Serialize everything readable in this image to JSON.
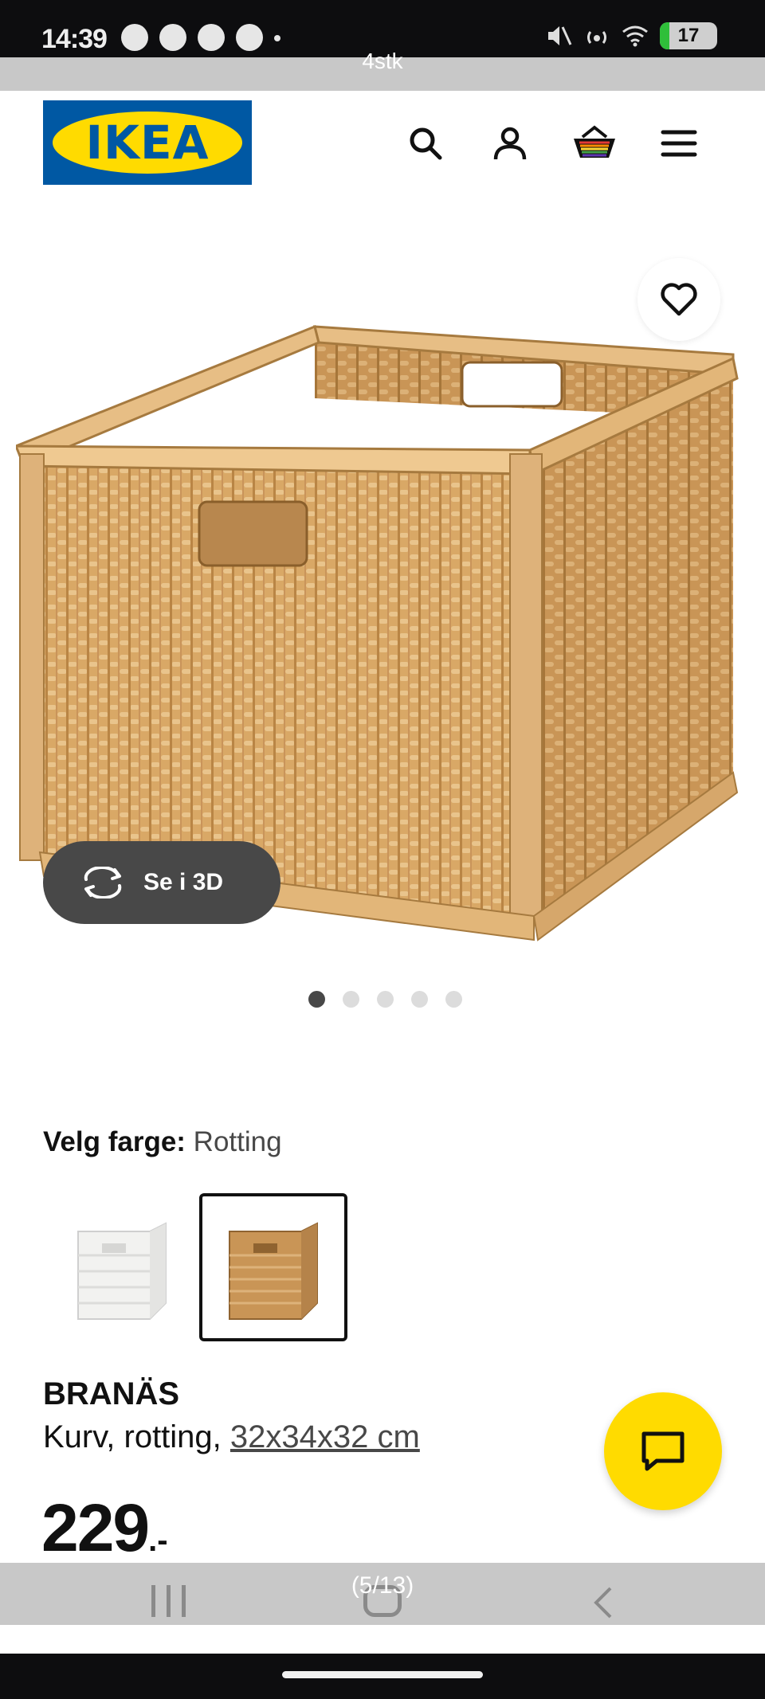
{
  "status_bar": {
    "time": "14:39",
    "battery": "17"
  },
  "overlay_top": {
    "text": "4stk"
  },
  "header": {
    "logo_text": "IKEA",
    "icons": [
      "search-icon",
      "account-icon",
      "basket-icon",
      "menu-icon"
    ]
  },
  "gallery": {
    "see_3d_label": "Se i 3D",
    "dot_count": 5,
    "active_dot": 1
  },
  "color_picker": {
    "label": "Velg farge:",
    "value": "Rotting",
    "options": [
      "white",
      "rattan"
    ],
    "selected": "rattan"
  },
  "product": {
    "name": "BRANÄS",
    "description": "Kurv, rotting, ",
    "size": "32x34x32 cm",
    "price": "229",
    "price_suffix": ".-"
  },
  "bottom_overlay": {
    "page_indicator": "(5/13)"
  },
  "colors": {
    "ikea_blue": "#0058a3",
    "ikea_yellow": "#ffdb00",
    "dark_grey": "#484848"
  }
}
